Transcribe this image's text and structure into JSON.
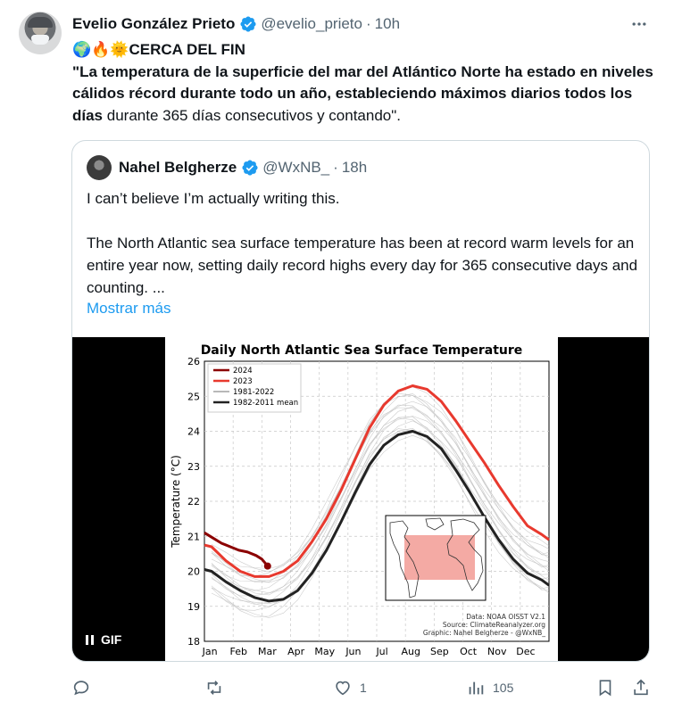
{
  "tweet": {
    "author_name": "Evelio González Prieto",
    "author_handle": "@evelio_prieto",
    "time": "10h",
    "emoji_prefix": "🌍🔥🌞",
    "headline": "CERCA DEL FIN",
    "text_open": "\"",
    "text_bold": "La temperatura de la superficie del mar del Atlántico Norte ha estado en niveles cálidos récord durante todo un año, estableciendo máximos diarios todos los días",
    "text_rest": " durante 365 días consecutivos y contando\"."
  },
  "quote": {
    "author_name": "Nahel Belgherze",
    "author_handle": "@WxNB_",
    "time": "18h",
    "paragraph1": "I can’t believe I’m actually writing this.",
    "paragraph2": "The North Atlantic sea surface temperature has been at record warm levels for an entire year now, setting daily record highs every day for 365 consecutive days and counting. ...",
    "show_more": "Mostrar más",
    "gif_label": "GIF"
  },
  "actions": {
    "replies": "",
    "retweets": "",
    "likes": "1",
    "views": "105"
  },
  "colors": {
    "accent": "#1d9bf0",
    "text": "#0f1419",
    "muted": "#536471",
    "series_2024": "#8b0000",
    "series_2023": "#e8392e",
    "series_hist": "#b8b8b8",
    "series_mean": "#222222"
  },
  "chart_data": {
    "type": "line",
    "title": "Daily North Atlantic Sea Surface Temperature",
    "ylabel": "Temperature (°C)",
    "xlabel": "",
    "categories": [
      "Jan",
      "Feb",
      "Mar",
      "Apr",
      "May",
      "Jun",
      "Jul",
      "Aug",
      "Sep",
      "Oct",
      "Nov",
      "Dec"
    ],
    "ylim": [
      18,
      26
    ],
    "yticks": [
      "18",
      "19",
      "20",
      "21",
      "22",
      "23",
      "24",
      "25",
      "26"
    ],
    "grid": true,
    "legend_position": "top-left",
    "series": [
      {
        "name": "2024",
        "color": "#8b0000",
        "points": [
          [
            0,
            21.1
          ],
          [
            0.3,
            20.95
          ],
          [
            0.6,
            20.8
          ],
          [
            0.9,
            20.7
          ],
          [
            1.2,
            20.6
          ],
          [
            1.5,
            20.55
          ],
          [
            1.8,
            20.45
          ],
          [
            2.0,
            20.35
          ],
          [
            2.1,
            20.25
          ],
          [
            2.2,
            20.15
          ]
        ]
      },
      {
        "name": "2023",
        "color": "#e8392e",
        "points": [
          [
            0,
            20.7
          ],
          [
            0.5,
            20.3
          ],
          [
            1.0,
            20.0
          ],
          [
            1.5,
            19.85
          ],
          [
            2.0,
            19.85
          ],
          [
            2.5,
            20.0
          ],
          [
            3.0,
            20.3
          ],
          [
            3.5,
            20.85
          ],
          [
            4.0,
            21.5
          ],
          [
            4.5,
            22.3
          ],
          [
            5.0,
            23.2
          ],
          [
            5.5,
            24.1
          ],
          [
            6.0,
            24.75
          ],
          [
            6.5,
            25.15
          ],
          [
            7.0,
            25.3
          ],
          [
            7.5,
            25.2
          ],
          [
            8.0,
            24.85
          ],
          [
            8.5,
            24.3
          ],
          [
            9.0,
            23.7
          ],
          [
            9.5,
            23.1
          ],
          [
            10.0,
            22.45
          ],
          [
            10.5,
            21.85
          ],
          [
            11.0,
            21.3
          ],
          [
            11.5,
            21.05
          ]
        ]
      },
      {
        "name": "1981-2022",
        "color": "#b8b8b8",
        "points": [
          [
            0,
            19.5
          ],
          [
            0.5,
            19.2
          ],
          [
            1.0,
            18.95
          ],
          [
            1.5,
            18.85
          ],
          [
            2.0,
            18.85
          ],
          [
            2.5,
            19.05
          ],
          [
            3.0,
            19.4
          ],
          [
            3.5,
            19.95
          ],
          [
            4.0,
            20.65
          ],
          [
            4.5,
            21.45
          ],
          [
            5.0,
            22.3
          ],
          [
            5.5,
            23.1
          ],
          [
            6.0,
            23.65
          ],
          [
            6.5,
            23.95
          ],
          [
            7.0,
            24.0
          ],
          [
            7.5,
            23.75
          ],
          [
            8.0,
            23.35
          ],
          [
            8.5,
            22.8
          ],
          [
            9.0,
            22.1
          ],
          [
            9.5,
            21.4
          ],
          [
            10.0,
            20.75
          ],
          [
            10.5,
            20.2
          ],
          [
            11.0,
            19.8
          ],
          [
            11.5,
            19.55
          ]
        ]
      },
      {
        "name": "1982-2011 mean",
        "color": "#222222",
        "points": [
          [
            0,
            20.0
          ],
          [
            0.5,
            19.7
          ],
          [
            1.0,
            19.45
          ],
          [
            1.5,
            19.25
          ],
          [
            2.0,
            19.15
          ],
          [
            2.5,
            19.2
          ],
          [
            3.0,
            19.45
          ],
          [
            3.5,
            19.95
          ],
          [
            4.0,
            20.6
          ],
          [
            4.5,
            21.4
          ],
          [
            5.0,
            22.25
          ],
          [
            5.5,
            23.05
          ],
          [
            6.0,
            23.6
          ],
          [
            6.5,
            23.9
          ],
          [
            7.0,
            24.0
          ],
          [
            7.5,
            23.85
          ],
          [
            8.0,
            23.5
          ],
          [
            8.5,
            22.9
          ],
          [
            9.0,
            22.25
          ],
          [
            9.5,
            21.55
          ],
          [
            10.0,
            20.9
          ],
          [
            10.5,
            20.35
          ],
          [
            11.0,
            19.95
          ],
          [
            11.5,
            19.75
          ]
        ]
      }
    ],
    "annotation_lines": [
      "Data: NOAA OISST V2.1",
      "Source: ClimateReanalyzer.org",
      "Graphic: Nahel Belgherze - @WxNB_"
    ]
  }
}
